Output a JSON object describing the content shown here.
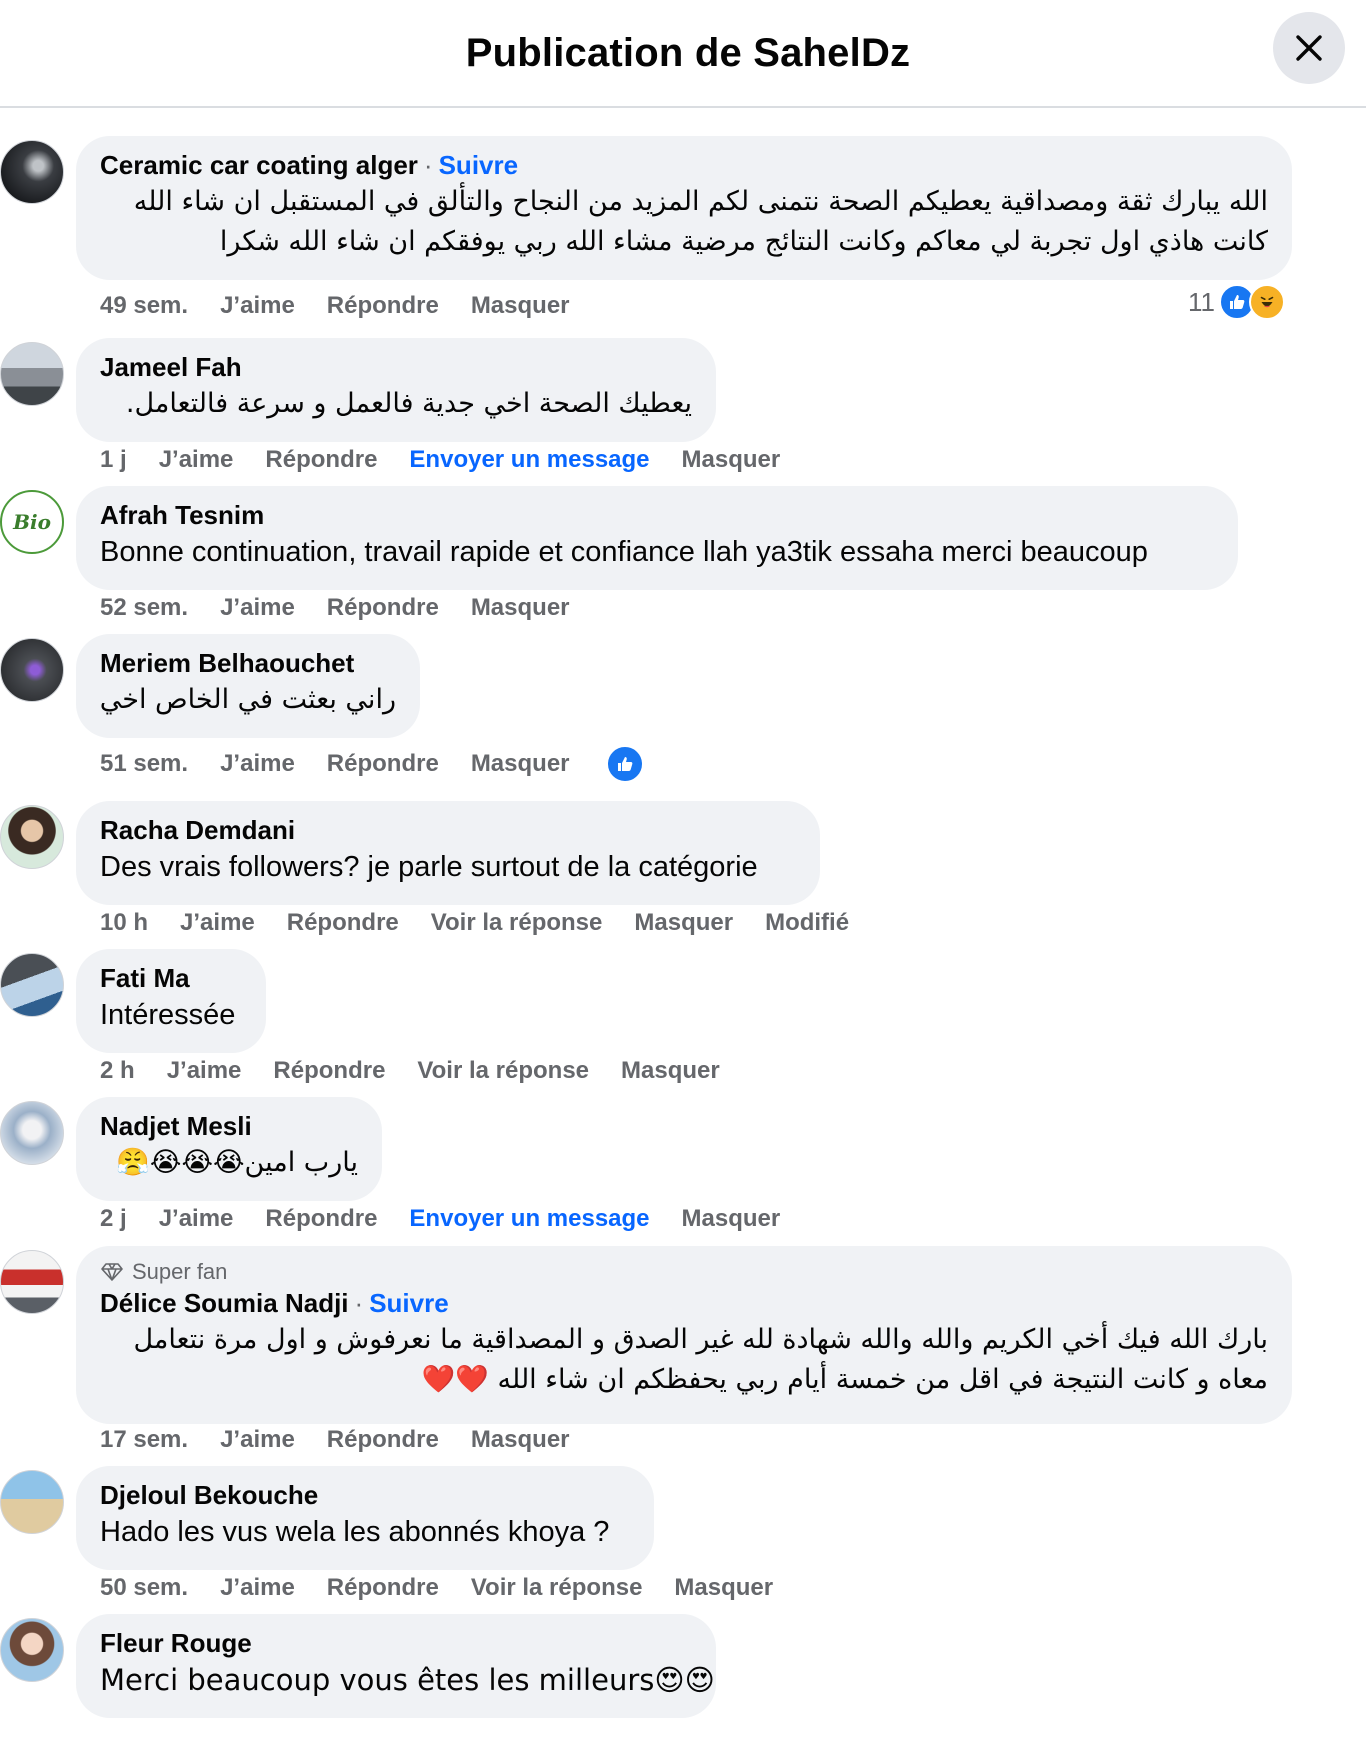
{
  "header": {
    "title": "Publication de SahelDz"
  },
  "comments": [
    {
      "author": "Ceramic car coating alger",
      "follow": "Suivre",
      "lines": [
        "الله يبارك ثقة ومصداقية يعطيكم الصحة نتمنى لكم المزيد من النجاح والتألق في المستقبل ان شاء الله",
        "كانت هاذي اول تجربة لي معاكم وكانت النتائج مرضية مشاء الله ربي يوفقكم ان شاء الله شكرا"
      ],
      "time": "49 sem.",
      "like": "J’aime",
      "reply": "Répondre",
      "hide": "Masquer",
      "reaction_count": "11"
    },
    {
      "author": "Jameel Fah",
      "text": "يعطيك الصحة اخي جدية فالعمل و سرعة فالتعامل.",
      "time": "1 j",
      "like": "J’aime",
      "reply": "Répondre",
      "message": "Envoyer un message",
      "hide": "Masquer"
    },
    {
      "author": "Afrah Tesnim",
      "text": "Bonne continuation, travail rapide et confiance llah ya3tik essaha merci beaucoup",
      "time": "52 sem.",
      "like": "J’aime",
      "reply": "Répondre",
      "hide": "Masquer"
    },
    {
      "author": "Meriem Belhaouchet",
      "text": "راني بعثت في الخاص اخي",
      "time": "51 sem.",
      "like": "J’aime",
      "reply": "Répondre",
      "hide": "Masquer"
    },
    {
      "author": "Racha Demdani",
      "text": "Des vrais followers? je parle surtout de la catégorie",
      "time": "10 h",
      "like": "J’aime",
      "reply": "Répondre",
      "view_reply": "Voir la réponse",
      "hide": "Masquer",
      "edited": "Modifié"
    },
    {
      "author": "Fati Ma",
      "text": "Intéressée",
      "time": "2 h",
      "like": "J’aime",
      "reply": "Répondre",
      "view_reply": "Voir la réponse",
      "hide": "Masquer"
    },
    {
      "author": "Nadjet Mesli",
      "text": "يارب امين😭😭😭😤",
      "time": "2 j",
      "like": "J’aime",
      "reply": "Répondre",
      "message": "Envoyer un message",
      "hide": "Masquer"
    },
    {
      "badge": "Super fan",
      "author": "Délice Soumia Nadji",
      "follow": "Suivre",
      "lines": [
        "بارك الله فيك أخي الكريم والله والله شهادة لله غير الصدق و المصداقية ما نعرفوش و اول مرة نتعامل",
        "معاه و كانت النتيجة في اقل من خمسة أيام ربي يحفظكم ان شاء الله ❤️❤️"
      ],
      "time": "17 sem.",
      "like": "J’aime",
      "reply": "Répondre",
      "hide": "Masquer"
    },
    {
      "author": "Djeloul Bekouche",
      "text": "Hado les vus wela les abonnés khoya ?",
      "time": "50 sem.",
      "like": "J’aime",
      "reply": "Répondre",
      "view_reply": "Voir la réponse",
      "hide": "Masquer"
    },
    {
      "author": "Fleur Rouge",
      "text": "Merci beaucoup vous êtes les milleurs😍😍"
    }
  ],
  "colors": {
    "accent": "#0866ff",
    "bubble": "#f0f2f5",
    "meta": "#65676b"
  }
}
